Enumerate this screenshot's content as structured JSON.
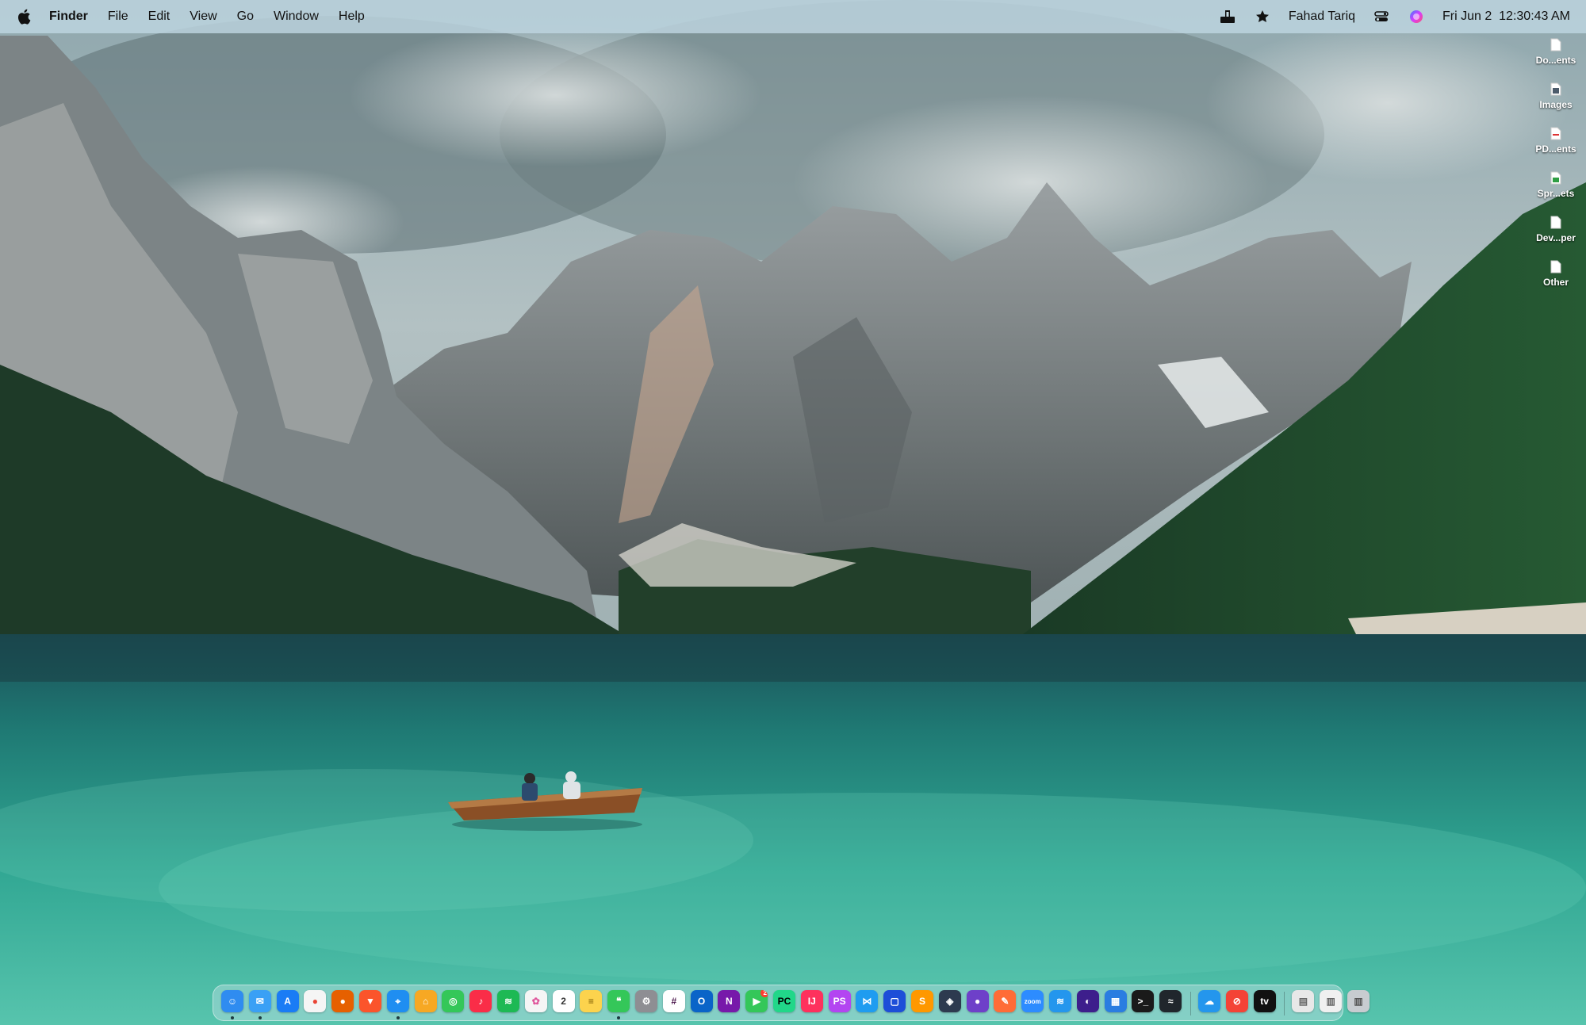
{
  "menubar": {
    "app_name": "Finder",
    "menus": [
      "File",
      "Edit",
      "View",
      "Go",
      "Window",
      "Help"
    ],
    "user_name": "Fahad Tariq",
    "datetime": "Fri Jun 2  12:30:43 AM",
    "status_icons": [
      "share-tray-icon",
      "star-icon",
      "control-center-icon",
      "siri-icon"
    ]
  },
  "desktop": {
    "stacks": [
      "Do...ents",
      "Images",
      "PD...ents",
      "Spr...ets",
      "Dev...per",
      "Other"
    ]
  },
  "dock": {
    "apps": [
      {
        "name": "finder",
        "bg": "#2f8cf0",
        "glyph": "☺",
        "running": true
      },
      {
        "name": "mail",
        "bg": "#3aa0f5",
        "glyph": "✉",
        "running": true
      },
      {
        "name": "app-store",
        "bg": "#1a7cf5",
        "glyph": "A"
      },
      {
        "name": "chrome",
        "bg": "#f5f5f5",
        "glyph": "●",
        "fg": "#e94335"
      },
      {
        "name": "firefox",
        "bg": "#e66000",
        "glyph": "●"
      },
      {
        "name": "brave",
        "bg": "#fb542b",
        "glyph": "▼"
      },
      {
        "name": "safari",
        "bg": "#1f8ef1",
        "glyph": "⌖",
        "running": true
      },
      {
        "name": "home",
        "bg": "#f7a823",
        "glyph": "⌂"
      },
      {
        "name": "find-my",
        "bg": "#34c759",
        "glyph": "◎"
      },
      {
        "name": "music",
        "bg": "#fa2d48",
        "glyph": "♪"
      },
      {
        "name": "spotify",
        "bg": "#1db954",
        "glyph": "≋"
      },
      {
        "name": "photos",
        "bg": "#f5f5f5",
        "glyph": "✿",
        "fg": "#e0559b"
      },
      {
        "name": "calendar",
        "bg": "#ffffff",
        "glyph": "2",
        "fg": "#333"
      },
      {
        "name": "notes",
        "bg": "#fcd34d",
        "glyph": "≡",
        "fg": "#7a5a00"
      },
      {
        "name": "messages",
        "bg": "#34c759",
        "glyph": "❝",
        "running": true
      },
      {
        "name": "system-settings",
        "bg": "#8e8e93",
        "glyph": "⚙"
      },
      {
        "name": "slack",
        "bg": "#ffffff",
        "glyph": "#",
        "fg": "#4a154b"
      },
      {
        "name": "outlook",
        "bg": "#0a64c8",
        "glyph": "O"
      },
      {
        "name": "onenote",
        "bg": "#7719aa",
        "glyph": "N"
      },
      {
        "name": "facetime",
        "bg": "#34c759",
        "glyph": "▶",
        "badge": "2"
      },
      {
        "name": "pycharm",
        "bg": "#21d789",
        "glyph": "PC",
        "fg": "#000"
      },
      {
        "name": "intellij",
        "bg": "#fe315d",
        "glyph": "IJ"
      },
      {
        "name": "phpstorm",
        "bg": "#b345f1",
        "glyph": "PS"
      },
      {
        "name": "vscode",
        "bg": "#1f9cf0",
        "glyph": "⋈"
      },
      {
        "name": "jetbrains-toolbox",
        "bg": "#1d4ed8",
        "glyph": "▢"
      },
      {
        "name": "sublime-text",
        "bg": "#ff9800",
        "glyph": "S"
      },
      {
        "name": "openvpn",
        "bg": "#2d3a4f",
        "glyph": "◈"
      },
      {
        "name": "github-desktop",
        "bg": "#6e40c9",
        "glyph": "●"
      },
      {
        "name": "postman",
        "bg": "#ff6c37",
        "glyph": "✎"
      },
      {
        "name": "zoom",
        "bg": "#2d8cff",
        "glyph": "zoom"
      },
      {
        "name": "docker",
        "bg": "#2496ed",
        "glyph": "≋"
      },
      {
        "name": "mongodb-compass",
        "bg": "#3d1e8c",
        "glyph": "◐"
      },
      {
        "name": "tableplus",
        "bg": "#2a7de1",
        "glyph": "▦"
      },
      {
        "name": "terminal",
        "bg": "#1a1a1a",
        "glyph": ">_"
      },
      {
        "name": "activity-monitor",
        "bg": "#20262c",
        "glyph": "≈"
      },
      {
        "name": "docker-desktop",
        "bg": "#2496ed",
        "glyph": "☁",
        "separator_before": true
      },
      {
        "name": "mastodon",
        "bg": "#f44336",
        "glyph": "⊘"
      },
      {
        "name": "apple-tv",
        "bg": "#111111",
        "glyph": "tv"
      },
      {
        "name": "downloads-stack",
        "bg": "#e8e8e8",
        "glyph": "▤",
        "fg": "#666",
        "separator_before": true
      },
      {
        "name": "documents-stack",
        "bg": "#f0f0f0",
        "glyph": "▥",
        "fg": "#666"
      },
      {
        "name": "trash",
        "bg": "#c8ccd0",
        "glyph": "▥",
        "fg": "#555"
      }
    ]
  }
}
